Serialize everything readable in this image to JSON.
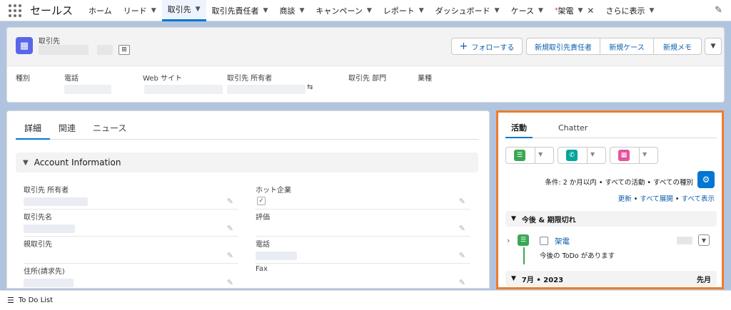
{
  "app": {
    "name": "セールス"
  },
  "nav": {
    "tabs": [
      {
        "label": "ホーム",
        "chevron": false
      },
      {
        "label": "リード",
        "chevron": true
      },
      {
        "label": "取引先",
        "chevron": true
      },
      {
        "label": "取引先責任者",
        "chevron": true
      },
      {
        "label": "商談",
        "chevron": true
      },
      {
        "label": "キャンペーン",
        "chevron": true
      },
      {
        "label": "レポート",
        "chevron": true
      },
      {
        "label": "ダッシュボード",
        "chevron": true
      },
      {
        "label": "ケース",
        "chevron": true
      }
    ],
    "active_tab": "取引先",
    "workspace_tab": {
      "marker": "*",
      "label": "架電"
    },
    "more_label": "さらに表示"
  },
  "header": {
    "object_label": "取引先",
    "buttons": {
      "follow": "フォローする",
      "new_contact": "新規取引先責任者",
      "new_case": "新規ケース",
      "new_note": "新規メモ"
    },
    "fields": {
      "type": "種別",
      "phone": "電話",
      "website": "Web サイト",
      "owner": "取引先 所有者",
      "division": "取引先 部門",
      "industry": "業種"
    }
  },
  "detail": {
    "tabs": [
      "詳細",
      "関連",
      "ニュース"
    ],
    "active_tab": "詳細",
    "section_title": "Account Information",
    "left_fields": [
      "取引先 所有者",
      "取引先名",
      "親取引先",
      "住所(請求先)"
    ],
    "right_fields": [
      "ホット企業",
      "評価",
      "電話",
      "Fax"
    ],
    "hot_checked": true
  },
  "activity": {
    "tabs": [
      "活動",
      "Chatter"
    ],
    "active_tab": "活動",
    "filter_text": "条件: 2 か月以内 • すべての活動 • すべての種別",
    "links": {
      "refresh": "更新",
      "expand_all": "すべて展開",
      "view_all": "すべて表示",
      "sep": "•"
    },
    "upcoming_header": "今後 & 期限切れ",
    "task": {
      "title": "架電",
      "subtitle": "今後の ToDo があります"
    },
    "month_header": "7月 • 2023",
    "month_right": "先月",
    "colors": {
      "task": "#3ba755",
      "call": "#06a59a",
      "event": "#e3549f",
      "accent": "#0176d3",
      "highlight": "#ee7c2b"
    }
  },
  "footer": {
    "todo_label": "To Do List"
  }
}
